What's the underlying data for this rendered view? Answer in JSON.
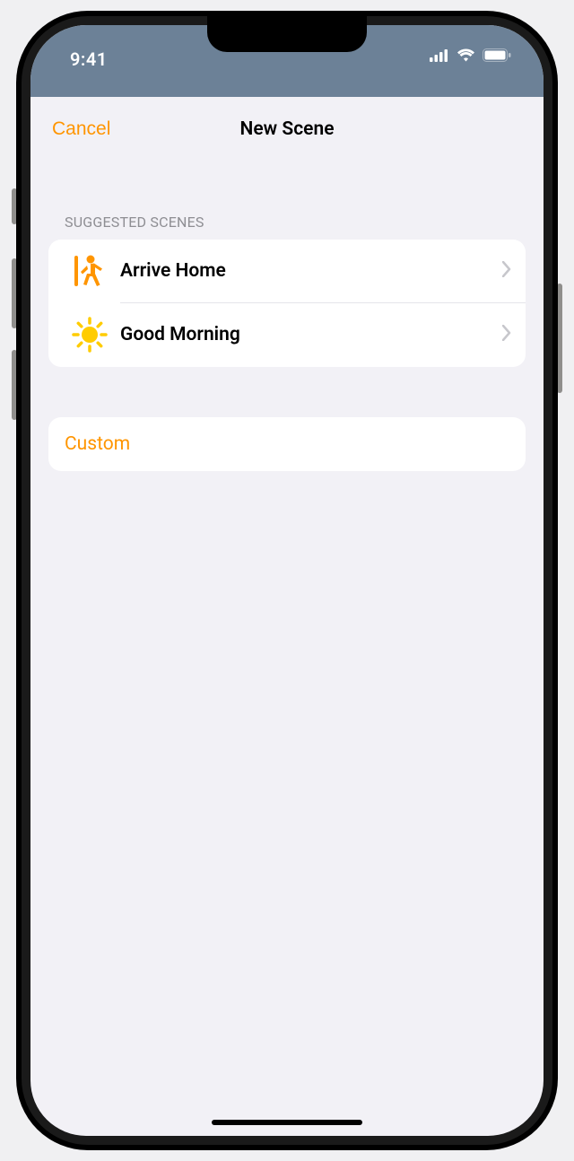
{
  "statusBar": {
    "time": "9:41"
  },
  "navBar": {
    "cancel": "Cancel",
    "title": "New Scene"
  },
  "sections": {
    "suggestedHeader": "SUGGESTED SCENES",
    "suggested": [
      {
        "label": "Arrive Home",
        "icon": "arrive-home-icon"
      },
      {
        "label": "Good Morning",
        "icon": "sun-icon"
      }
    ],
    "custom": "Custom"
  },
  "colors": {
    "accent": "#ff9500",
    "statusBg": "#6c8197",
    "sunYellow": "#ffcc00"
  }
}
